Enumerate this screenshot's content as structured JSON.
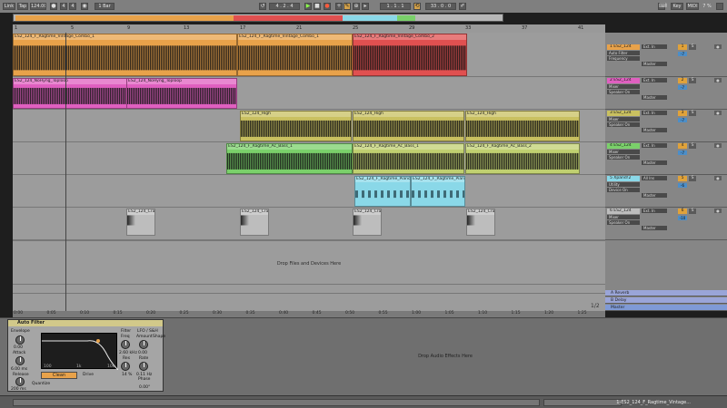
{
  "transport": {
    "link": "Link",
    "tap": "Tap",
    "tempo": "124.00",
    "sig_num": "4",
    "sig_den": "4",
    "quantize": "1 Bar",
    "position": "4 .  2 .  4",
    "loop_start": "1 .  1 .  1",
    "loop_len": "33 .  0 .  0",
    "key": "Key",
    "midi": "MIDI",
    "cpu": "7 %"
  },
  "ruler_bars": [
    "1",
    "5",
    "9",
    "13",
    "17",
    "21",
    "25",
    "29",
    "33",
    "37",
    "41"
  ],
  "time_ticks": [
    "0:00",
    "0:05",
    "0:10",
    "0:15",
    "0:20",
    "0:25",
    "0:30",
    "0:35",
    "0:40",
    "0:45",
    "0:50",
    "0:55",
    "1:00",
    "1:05",
    "1:10",
    "1:15",
    "1:20",
    "1:25"
  ],
  "tracks": [
    {
      "id": 1,
      "name": "1 ES2_124",
      "color": "#e8a24a",
      "clips": [
        {
          "label": "ES2_124_F_Ragtime_Vintage_Combo_1",
          "color": "#e8a24a"
        },
        {
          "label": "ES2_124_F_Ragtime_Vintage_Combo_1",
          "color": "#e8a24a"
        },
        {
          "label": "ES2_124_F_Ragtime_Vintage_Combo_2",
          "color": "#e05050"
        }
      ],
      "mixer": {
        "input": "Ext. In",
        "device": "Auto Filter",
        "param": "Frequency",
        "number": "1",
        "output": "Master",
        "vol": "-7"
      }
    },
    {
      "id": 2,
      "name": "2 ES2_124",
      "color": "#e060c0",
      "clips": [
        {
          "label": "ES2_124_NoHyng_Toploop",
          "color": "#e060c0"
        },
        {
          "label": "ES2_124_NoHyng_Toploop",
          "color": "#e060c0"
        }
      ],
      "mixer": {
        "input": "Ext. In",
        "device": "Mixer",
        "param": "Speaker On",
        "number": "2",
        "output": "Master",
        "vol": "-7"
      }
    },
    {
      "id": 3,
      "name": "3 ES2_124",
      "color": "#c9c060",
      "clips": [
        {
          "label": "ES2_124_High",
          "color": "#c9c060"
        },
        {
          "label": "ES2_124_High",
          "color": "#c9c060"
        },
        {
          "label": "ES2_124_High",
          "color": "#c9c060"
        }
      ],
      "mixer": {
        "input": "Ext. In",
        "device": "Mixer",
        "param": "Speaker On",
        "number": "3",
        "output": "Master",
        "vol": "-7"
      }
    },
    {
      "id": 4,
      "name": "4 ES2_124",
      "color": "#7ad06a",
      "clips": [
        {
          "label": "ES2_124_F_Ragtime_Ac_Bass_1",
          "color": "#7ad06a"
        },
        {
          "label": "ES2_124_F_Ragtime_Ac_Bass_1",
          "color": "#c0d070"
        },
        {
          "label": "ES2_124_F_Ragtime_Ac_Bass_2",
          "color": "#c0d070"
        }
      ],
      "mixer": {
        "input": "Ext. In",
        "device": "Mixer",
        "param": "Speaker On",
        "number": "4",
        "output": "Master",
        "vol": "-7"
      }
    },
    {
      "id": 5,
      "name": "5 Xpand!2",
      "color": "#8ad8e8",
      "clips": [
        {
          "label": "ES2_124_F_Ragtime_Piano",
          "color": "#8ad8e8"
        },
        {
          "label": "ES2_124_F_Ragtime_Piano",
          "color": "#8ad8e8"
        }
      ],
      "mixer": {
        "input": "All Ins",
        "device": "Utility",
        "param": "Device On",
        "number": "5",
        "output": "Master",
        "vol": "-6"
      }
    },
    {
      "id": 6,
      "name": "6 ES2_124",
      "color": "#bdbdbd",
      "clips": [
        {
          "label": "ES2_124_Crash",
          "color": "#bdbdbd"
        },
        {
          "label": "ES2_124_Crash",
          "color": "#bdbdbd"
        },
        {
          "label": "ES2_124_Crash",
          "color": "#bdbdbd"
        },
        {
          "label": "ES2_124_Crash",
          "color": "#bdbdbd"
        }
      ],
      "mixer": {
        "input": "Ext. In",
        "device": "Mixer",
        "param": "Speaker On",
        "number": "6",
        "output": "Master",
        "vol": "-10"
      }
    }
  ],
  "arrangement": {
    "drop_hint": "Drop Files and Devices Here",
    "page": "1/2"
  },
  "returns": [
    {
      "name": "A Reverb",
      "letter": "A"
    },
    {
      "name": "B Delay",
      "letter": "B"
    },
    {
      "name": "Master",
      "letter": "0"
    }
  ],
  "device": {
    "name": "Auto Filter",
    "envelope": "Envelope",
    "attack_label": "Attack",
    "attack_val": "6.00 ms",
    "release_label": "Release",
    "release_val": "200 ms",
    "filter_label": "Filter",
    "freq_label": "Freq",
    "freq_val": "2.60 kHz",
    "res_label": "Res",
    "res_val": "14 %",
    "lfo_label": "LFO / S&H",
    "amount_label": "Amount",
    "shape_label": "Shape",
    "rate_label": "Rate",
    "rate_val": "0.11 Hz",
    "phase_label": "Phase",
    "phase_val": "0.00°",
    "quantize_label": "Quantize",
    "env_amount": "0.00",
    "lfo_amount": "0.00",
    "drive_label": "Drive",
    "type_label": "Clean",
    "freq_axis": [
      "100",
      "1k",
      "10k"
    ]
  },
  "device_drop_hint": "Drop Audio Effects Here",
  "status": {
    "text": "1-ES2_124_F_Ragtime_Vintage..."
  }
}
